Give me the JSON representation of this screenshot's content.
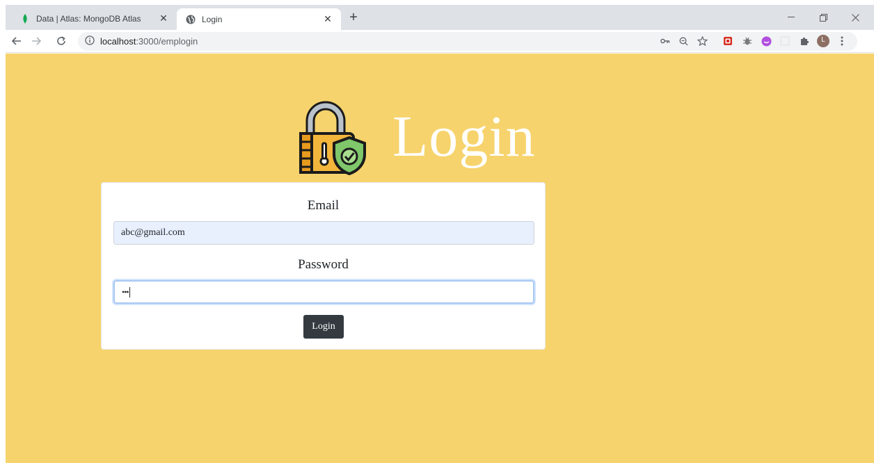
{
  "browser": {
    "tabs": [
      {
        "title": "Data | Atlas: MongoDB Atlas",
        "favicon": "mongodb-leaf-icon",
        "active": false
      },
      {
        "title": "Login",
        "favicon": "globe-icon",
        "active": true
      }
    ],
    "new_tab_label": "+",
    "url_host": "localhost",
    "url_path": ":3000/emplogin",
    "profile_initial": "L"
  },
  "page": {
    "background": "#f6d36c",
    "heading": "Login",
    "form": {
      "email_label": "Email",
      "email_value": "abc@gmail.com",
      "password_label": "Password",
      "password_mask": "•••",
      "submit_label": "Login"
    }
  },
  "colors": {
    "accent_button": "#343a40",
    "autofill_field": "#e8f0fe",
    "heading_text": "#ffffff"
  }
}
